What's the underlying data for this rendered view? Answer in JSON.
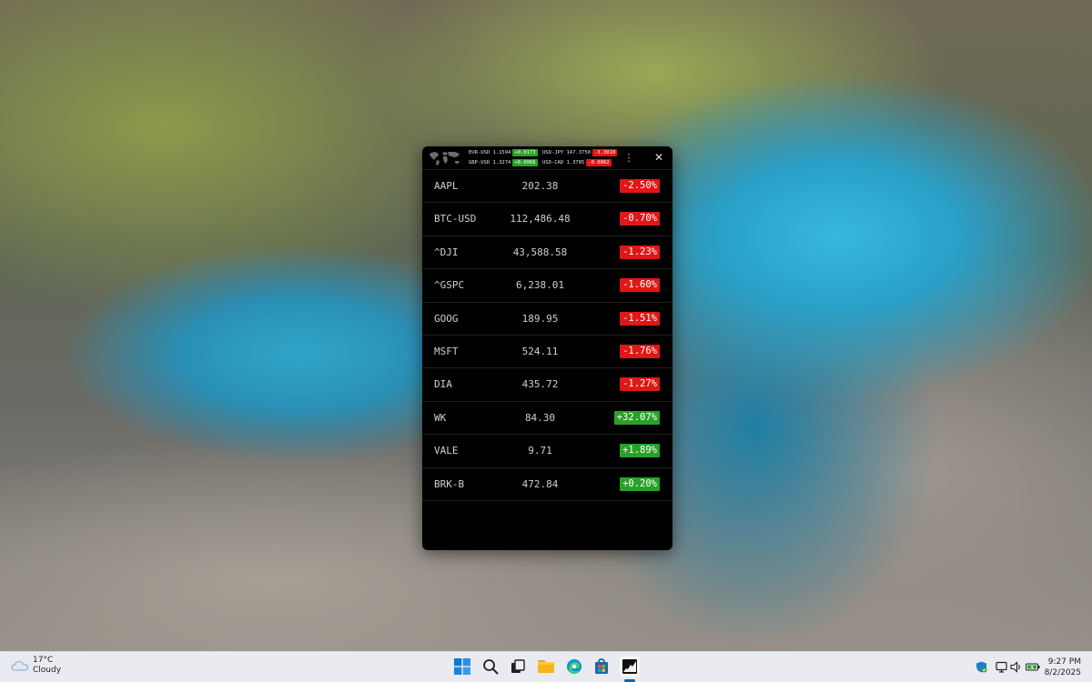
{
  "fx": [
    {
      "pair": "EUR-USD",
      "rate": "1.1594",
      "change": "+0.0173",
      "direction": "up"
    },
    {
      "pair": "USD-JPY",
      "rate": "147.3750",
      "change": "-3.3010",
      "direction": "down"
    },
    {
      "pair": "GBP-USD",
      "rate": "1.3274",
      "change": "+0.0066",
      "direction": "up"
    },
    {
      "pair": "USD-CAD",
      "rate": "1.3785",
      "change": "-0.0062",
      "direction": "down"
    }
  ],
  "stocks": [
    {
      "symbol": "AAPL",
      "price": "202.38",
      "change": "-2.50%",
      "direction": "down"
    },
    {
      "symbol": "BTC-USD",
      "price": "112,486.48",
      "change": "-0.70%",
      "direction": "down"
    },
    {
      "symbol": "^DJI",
      "price": "43,588.58",
      "change": "-1.23%",
      "direction": "down"
    },
    {
      "symbol": "^GSPC",
      "price": "6,238.01",
      "change": "-1.60%",
      "direction": "down"
    },
    {
      "symbol": "GOOG",
      "price": "189.95",
      "change": "-1.51%",
      "direction": "down"
    },
    {
      "symbol": "MSFT",
      "price": "524.11",
      "change": "-1.76%",
      "direction": "down"
    },
    {
      "symbol": "DIA",
      "price": "435.72",
      "change": "-1.27%",
      "direction": "down"
    },
    {
      "symbol": "WK",
      "price": "84.30",
      "change": "+32.07%",
      "direction": "up"
    },
    {
      "symbol": "VALE",
      "price": "9.71",
      "change": "+1.89%",
      "direction": "up"
    },
    {
      "symbol": "BRK-B",
      "price": "472.84",
      "change": "+0.20%",
      "direction": "up"
    }
  ],
  "colors": {
    "up": "#2aa12a",
    "down": "#e01717",
    "window_bg": "#000000"
  },
  "icons": {
    "menu": "more-vertical-icon",
    "close": "close-icon",
    "map": "world-map-icon"
  },
  "window_controls": {
    "menu_glyph": "⋮",
    "close_glyph": "✕"
  },
  "taskbar": {
    "weather": {
      "temp": "17°C",
      "condition": "Cloudy"
    },
    "apps": [
      "start",
      "search",
      "task-view",
      "file-explorer",
      "edge",
      "store",
      "stock-ticker"
    ],
    "clock": {
      "time": "9:27 PM",
      "date": "8/2/2025"
    }
  }
}
